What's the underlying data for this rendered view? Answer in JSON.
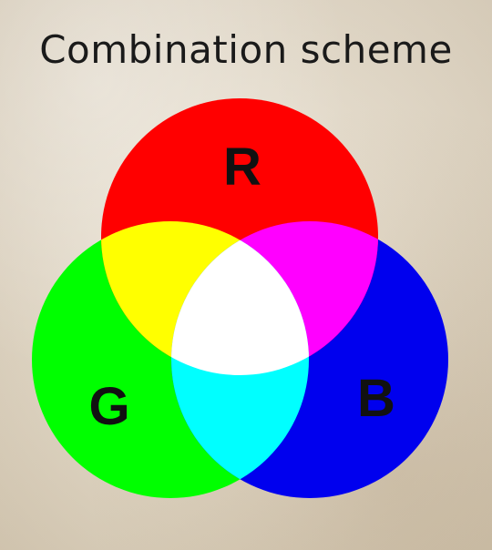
{
  "title": "Combination scheme",
  "circles": [
    {
      "key": "red",
      "label": "R",
      "color": "#ff0000"
    },
    {
      "key": "green",
      "label": "G",
      "color": "#00ff00"
    },
    {
      "key": "blue",
      "label": "B",
      "color": "#0000ee"
    }
  ],
  "overlaps": {
    "red_green": "#ffff00",
    "red_blue": "#ff00ff",
    "green_blue": "#00ffff",
    "all": "#ffffff"
  }
}
